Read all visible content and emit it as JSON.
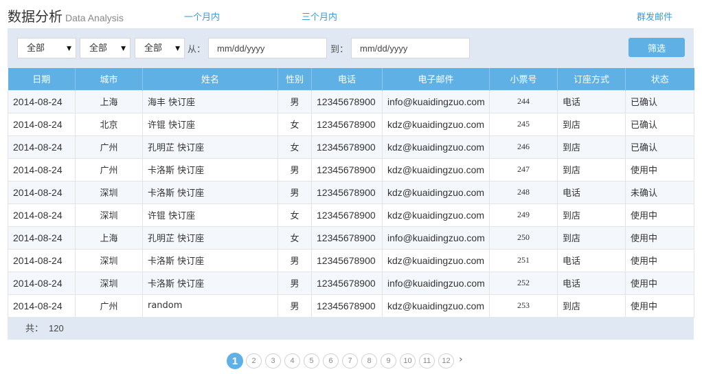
{
  "header": {
    "title": "数据分析",
    "subtitle": "Data Analysis",
    "links": {
      "one_month": "一个月内",
      "three_months": "三个月内",
      "group_mail": "群发邮件"
    }
  },
  "filters": {
    "selects": [
      "全部",
      "全部",
      "全部"
    ],
    "from_label": "从：",
    "to_label": "到：",
    "date_placeholder": "mm/dd/yyyy",
    "button": "筛选"
  },
  "table": {
    "columns": [
      "日期",
      "城市",
      "姓名",
      "性别",
      "电话",
      "电子邮件",
      "小票号",
      "订座方式",
      "状态"
    ],
    "rows": [
      [
        "2014-08-24",
        "上海",
        "海丰 快订座",
        "男",
        "12345678900",
        "info@kuaidingzuo.com",
        "244",
        "电话",
        "已确认"
      ],
      [
        "2014-08-24",
        "北京",
        "许锟 快订座",
        "女",
        "12345678900",
        "kdz@kuaidingzuo.com",
        "245",
        "到店",
        "已确认"
      ],
      [
        "2014-08-24",
        "广州",
        "孔明芷 快订座",
        "女",
        "12345678900",
        "kdz@kuaidingzuo.com",
        "246",
        "到店",
        "已确认"
      ],
      [
        "2014-08-24",
        "广州",
        "卡洛斯 快订座",
        "男",
        "12345678900",
        "kdz@kuaidingzuo.com",
        "247",
        "到店",
        "使用中"
      ],
      [
        "2014-08-24",
        "深圳",
        "卡洛斯 快订座",
        "男",
        "12345678900",
        "kdz@kuaidingzuo.com",
        "248",
        "电话",
        "未确认"
      ],
      [
        "2014-08-24",
        "深圳",
        "许锟 快订座",
        "女",
        "12345678900",
        "kdz@kuaidingzuo.com",
        "249",
        "到店",
        "使用中"
      ],
      [
        "2014-08-24",
        "上海",
        "孔明芷 快订座",
        "女",
        "12345678900",
        "info@kuaidingzuo.com",
        "250",
        "到店",
        "使用中"
      ],
      [
        "2014-08-24",
        "深圳",
        "卡洛斯 快订座",
        "男",
        "12345678900",
        "kdz@kuaidingzuo.com",
        "251",
        "电话",
        "使用中"
      ],
      [
        "2014-08-24",
        "深圳",
        "卡洛斯 快订座",
        "男",
        "12345678900",
        "info@kuaidingzuo.com",
        "252",
        "电话",
        "使用中"
      ],
      [
        "2014-08-24",
        "广州",
        "random",
        "男",
        "12345678900",
        "kdz@kuaidingzuo.com",
        "253",
        "到店",
        "使用中"
      ]
    ]
  },
  "footer": {
    "total_label": "共：",
    "total": "120"
  },
  "pagination": {
    "pages": [
      "1",
      "2",
      "3",
      "4",
      "5",
      "6",
      "7",
      "8",
      "9",
      "10",
      "11",
      "12"
    ],
    "current": "1",
    "next": "›"
  },
  "colors": {
    "accent": "#5fb1e5",
    "link": "#3a9ad9",
    "panel": "#dfe8f3"
  }
}
